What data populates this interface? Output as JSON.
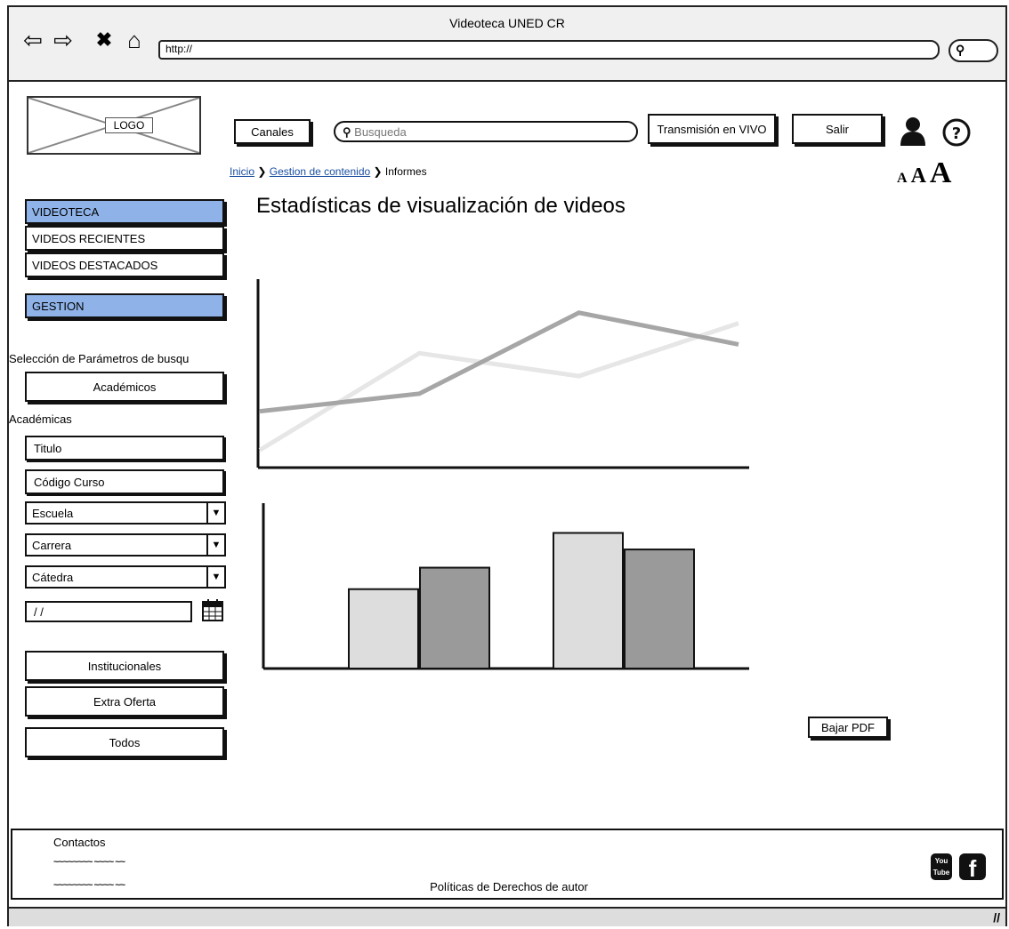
{
  "browser": {
    "title": "Videoteca UNED CR",
    "url": "http://",
    "icons": [
      "back-icon",
      "forward-icon",
      "stop-icon",
      "home-icon",
      "search-icon"
    ]
  },
  "header": {
    "logo": "LOGO",
    "channels_label": "Canales",
    "search_placeholder": "Busqueda",
    "live_label": "Transmisión en VIVO",
    "exit_label": "Salir",
    "font_sizes": [
      "A",
      "A",
      "A"
    ]
  },
  "breadcrumb": {
    "home": "Inicio",
    "content": "Gestion de contenido",
    "current": "Informes"
  },
  "sidebar": {
    "videoteca": "VIDEOTECA",
    "recent": "VIDEOS RECIENTES",
    "featured": "VIDEOS DESTACADOS",
    "gestion": "GESTION",
    "params_label": "Selección de Parámetros de busqu",
    "academicos_btn": "Académicos",
    "academicas_label": "Académicas",
    "titulo_field": "Titulo",
    "codigo_field": "Código Curso",
    "escuela_select": "Escuela",
    "carrera_select": "Carrera",
    "catedra_select": "Cátedra",
    "date_field": " / /",
    "institucionales_btn": "Institucionales",
    "extra_btn": "Extra Oferta",
    "todos_btn": "Todos"
  },
  "main": {
    "title": "Estadísticas de visualización de videos",
    "pdf_button": "Bajar PDF"
  },
  "chart_data": [
    {
      "type": "line",
      "x": [
        0,
        1,
        2,
        3
      ],
      "series": [
        {
          "values": [
            1,
            6.5,
            5.2,
            8.2
          ],
          "color": "#e6e6e6"
        },
        {
          "values": [
            3.2,
            4.2,
            8.8,
            7
          ]
        }
      ],
      "ylim": [
        0,
        10
      ]
    },
    {
      "type": "bar",
      "categories": [
        "",
        ""
      ],
      "series": [
        {
          "values": [
            4.8,
            8.2
          ],
          "color": "#dddddd"
        },
        {
          "values": [
            6.1,
            7.2
          ],
          "color": "#9a9a9a"
        }
      ],
      "ylim": [
        0,
        10
      ]
    }
  ],
  "footer": {
    "contacts_label": "Contactos",
    "contact_line_1": "~~~~~~~~ ~~~~ ~~",
    "contact_line_2": "~~~~~~~~ ~~~~ ~~",
    "copyright_label": "Políticas de Derechos de autor",
    "youtube_label": "You Tube"
  }
}
